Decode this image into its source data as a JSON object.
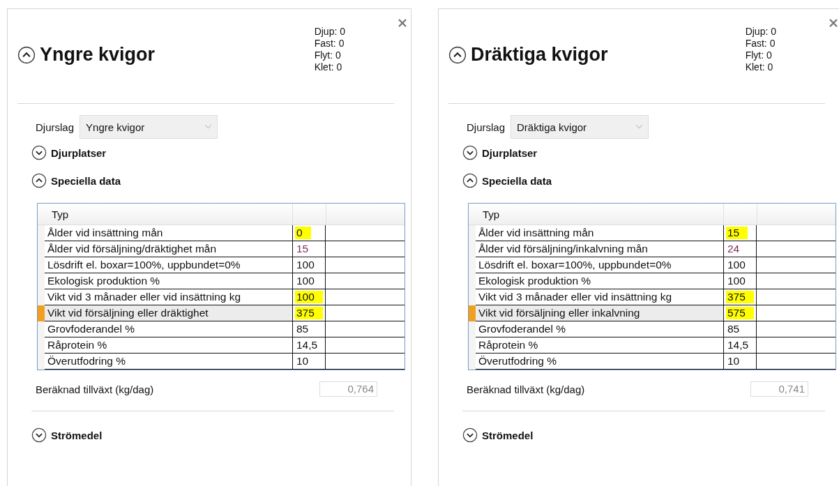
{
  "panels": [
    {
      "title": "Yngre kvigor",
      "expanded": true,
      "stats": [
        "Djup: 0",
        "Fast: 0",
        "Flyt: 0",
        "Klet: 0"
      ],
      "djurslag": {
        "label": "Djurslag",
        "value": "Yngre kvigor"
      },
      "sections": [
        {
          "label": "Djurplatser",
          "expanded": false
        },
        {
          "label": "Speciella data",
          "expanded": true
        }
      ],
      "table": {
        "columns": [
          "Typ"
        ],
        "rows": [
          {
            "label": "Ålder vid insättning mån",
            "value": "0",
            "highlighted": true,
            "kind": "input",
            "selected": false
          },
          {
            "label": "Ålder vid försäljning/dräktighet mån",
            "value": "15",
            "highlighted": false,
            "kind": "derived",
            "selected": false
          },
          {
            "label": "Lösdrift el. boxar=100%, uppbundet=0%",
            "value": "100",
            "highlighted": false,
            "kind": "input",
            "selected": false
          },
          {
            "label": "Ekologisk produktion %",
            "value": "100",
            "highlighted": false,
            "kind": "input",
            "selected": false
          },
          {
            "label": "Vikt vid 3 månader eller vid insättning kg",
            "value": "100",
            "highlighted": true,
            "kind": "input",
            "selected": false
          },
          {
            "label": "Vikt vid försäljning eller dräktighet",
            "value": "375",
            "highlighted": true,
            "kind": "input",
            "selected": true
          },
          {
            "label": "Grovfoderandel %",
            "value": "85",
            "highlighted": false,
            "kind": "input",
            "selected": false
          },
          {
            "label": "Råprotein %",
            "value": "14,5",
            "highlighted": false,
            "kind": "input",
            "selected": false
          },
          {
            "label": "Överutfodring %",
            "value": "10",
            "highlighted": false,
            "kind": "input",
            "selected": false
          }
        ]
      },
      "result": {
        "label": "Beräknad tillväxt (kg/dag)",
        "value": "0,764"
      },
      "footer_section": {
        "label": "Strömedel",
        "expanded": false
      }
    },
    {
      "title": "Dräktiga kvigor",
      "expanded": true,
      "stats": [
        "Djup: 0",
        "Fast: 0",
        "Flyt: 0",
        "Klet: 0"
      ],
      "djurslag": {
        "label": "Djurslag",
        "value": "Dräktiga kvigor"
      },
      "sections": [
        {
          "label": "Djurplatser",
          "expanded": false
        },
        {
          "label": "Speciella data",
          "expanded": true
        }
      ],
      "table": {
        "columns": [
          "Typ"
        ],
        "rows": [
          {
            "label": "Ålder vid insättning  mån",
            "value": "15",
            "highlighted": true,
            "kind": "input",
            "selected": false
          },
          {
            "label": "Ålder vid försäljning/inkalvning mån",
            "value": "24",
            "highlighted": false,
            "kind": "derived",
            "selected": false
          },
          {
            "label": "Lösdrift el. boxar=100%, uppbundet=0%",
            "value": "100",
            "highlighted": false,
            "kind": "input",
            "selected": false
          },
          {
            "label": "Ekologisk produktion %",
            "value": "100",
            "highlighted": false,
            "kind": "input",
            "selected": false
          },
          {
            "label": "Vikt vid 3 månader eller vid insättning kg",
            "value": "375",
            "highlighted": true,
            "kind": "input",
            "selected": false
          },
          {
            "label": "Vikt vid försäljning eller inkalvning",
            "value": "575",
            "highlighted": true,
            "kind": "input",
            "selected": true
          },
          {
            "label": "Grovfoderandel %",
            "value": "85",
            "highlighted": false,
            "kind": "input",
            "selected": false
          },
          {
            "label": "Råprotein %",
            "value": "14,5",
            "highlighted": false,
            "kind": "input",
            "selected": false
          },
          {
            "label": "Överutfodring %",
            "value": "10",
            "highlighted": false,
            "kind": "input",
            "selected": false
          }
        ]
      },
      "result": {
        "label": "Beräknad tillväxt (kg/dag)",
        "value": "0,741"
      },
      "footer_section": {
        "label": "Strömedel",
        "expanded": false
      }
    }
  ]
}
